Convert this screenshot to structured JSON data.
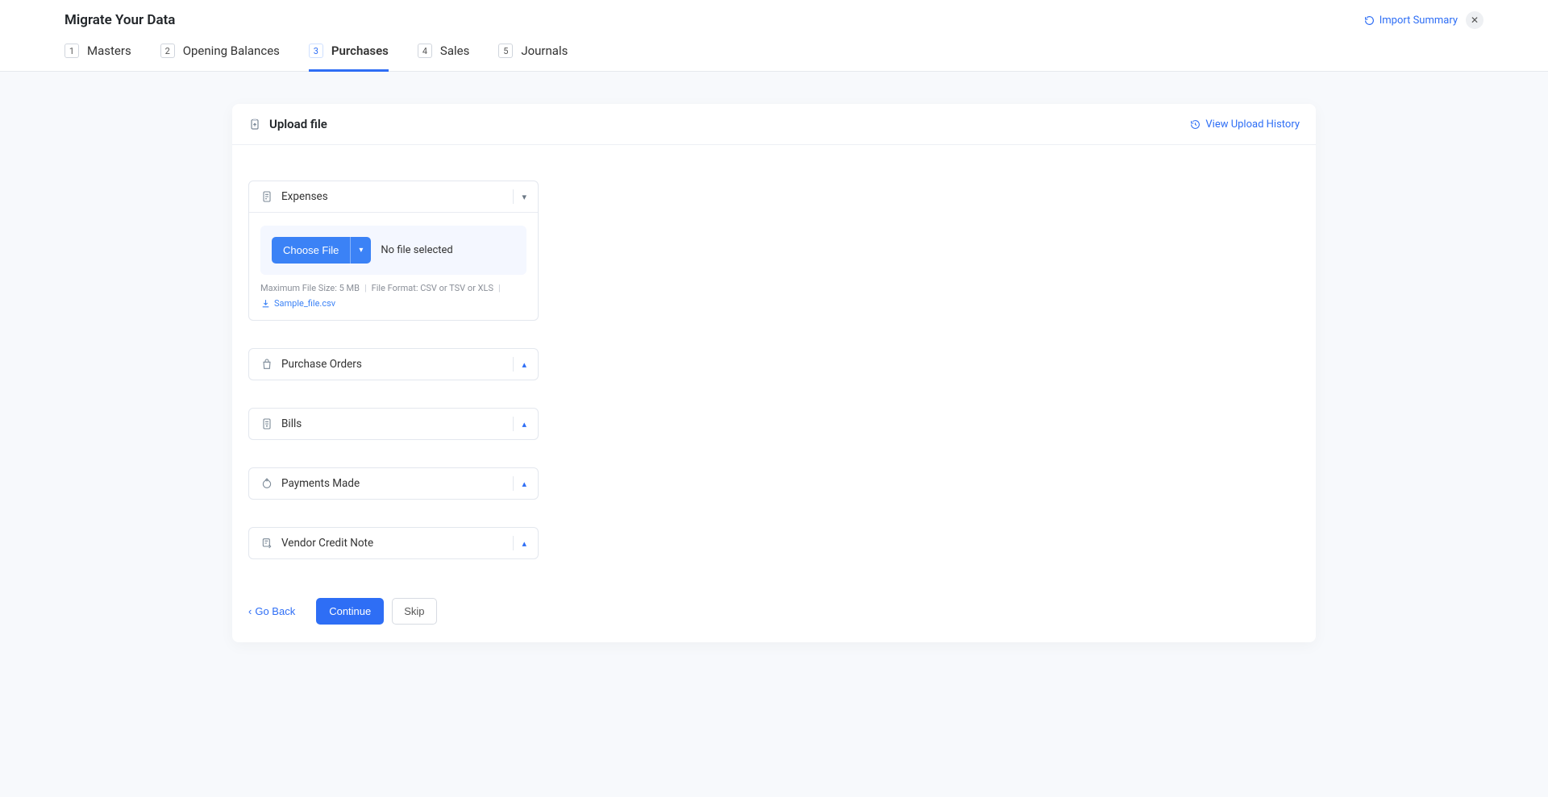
{
  "header": {
    "title": "Migrate Your Data",
    "import_summary": "Import Summary"
  },
  "tabs": [
    {
      "num": "1",
      "label": "Masters"
    },
    {
      "num": "2",
      "label": "Opening Balances"
    },
    {
      "num": "3",
      "label": "Purchases"
    },
    {
      "num": "4",
      "label": "Sales"
    },
    {
      "num": "5",
      "label": "Journals"
    }
  ],
  "card": {
    "title": "Upload file",
    "history": "View Upload History"
  },
  "sections": {
    "expenses": "Expenses",
    "purchase_orders": "Purchase Orders",
    "bills": "Bills",
    "payments_made": "Payments Made",
    "vendor_credit": "Vendor Credit Note"
  },
  "file": {
    "choose": "Choose File",
    "none": "No file selected",
    "max_size": "Maximum File Size: 5 MB",
    "format": "File Format: CSV or TSV or XLS",
    "sample": "Sample_file.csv"
  },
  "footer": {
    "back": "Go Back",
    "continue": "Continue",
    "skip": "Skip"
  }
}
